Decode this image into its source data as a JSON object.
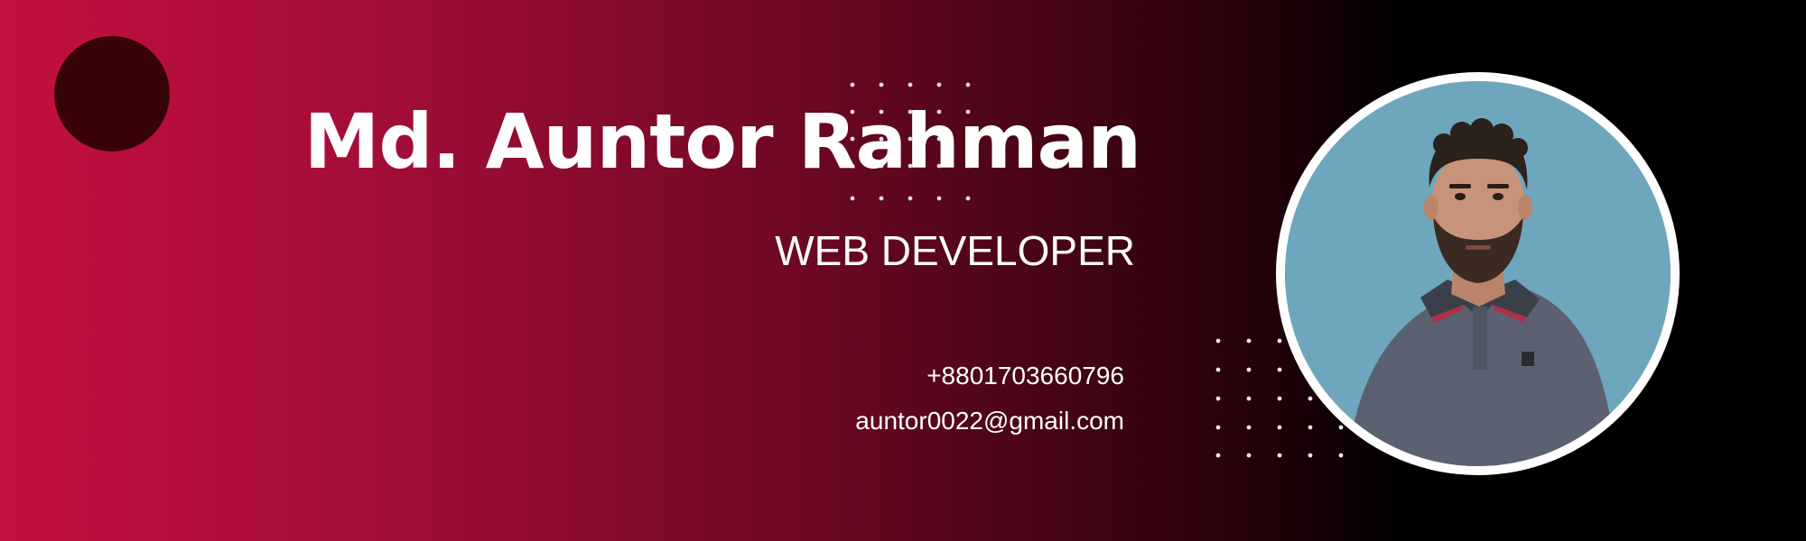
{
  "profile": {
    "name": "Md. Auntor Rahman",
    "role": "WEB DEVELOPER",
    "phone": "+8801703660796",
    "email": "auntor0022@gmail.com",
    "photo_icon": "person-portrait"
  },
  "colors": {
    "gradient_start": "#c4103f",
    "gradient_end": "#000000",
    "accent_circle": "#370307",
    "text": "#ffffff",
    "photo_background": "#6ea6bd",
    "photo_border": "#ffffff"
  }
}
